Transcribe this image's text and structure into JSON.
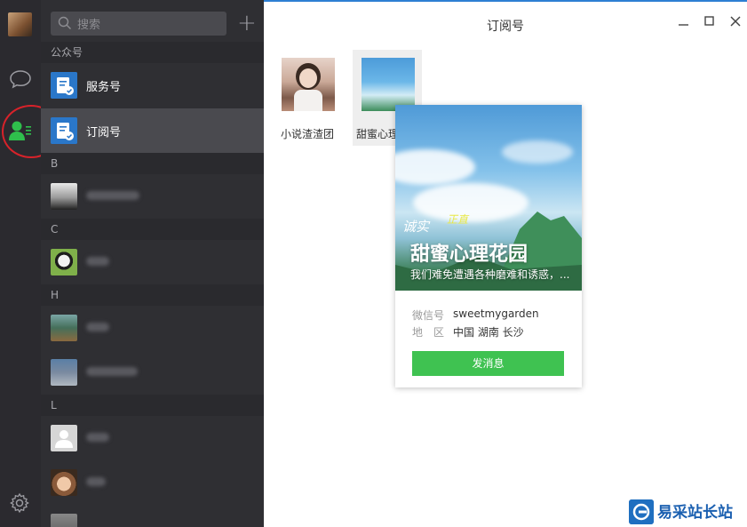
{
  "sidebar": {
    "search_placeholder": "搜索",
    "groups": {
      "official": "公众号",
      "b": "B",
      "c": "C",
      "h": "H",
      "l": "L"
    },
    "items": {
      "service": "服务号",
      "subscription": "订阅号"
    }
  },
  "main": {
    "title": "订阅号",
    "accounts": [
      {
        "label": "小说渣渣团"
      },
      {
        "label": "甜蜜心理花园"
      }
    ]
  },
  "card": {
    "title": "甜蜜心理花园",
    "subtitle": "我们难免遭遇各种磨难和诱惑，...",
    "calligraphy_left": "诚实",
    "calligraphy_mid": "正直",
    "wechat_id_label": "微信号",
    "wechat_id": "sweetmygarden",
    "region_label": "地　区",
    "region": "中国 湖南 长沙",
    "send_button": "发消息"
  },
  "watermark": {
    "text": "易采站长站"
  },
  "colors": {
    "rail_bg": "#2b2a2f",
    "list_bg": "#2f2f33",
    "active_row": "#4a4a4f",
    "accent_green": "#3fc251",
    "annotation_red": "#d8222a"
  }
}
